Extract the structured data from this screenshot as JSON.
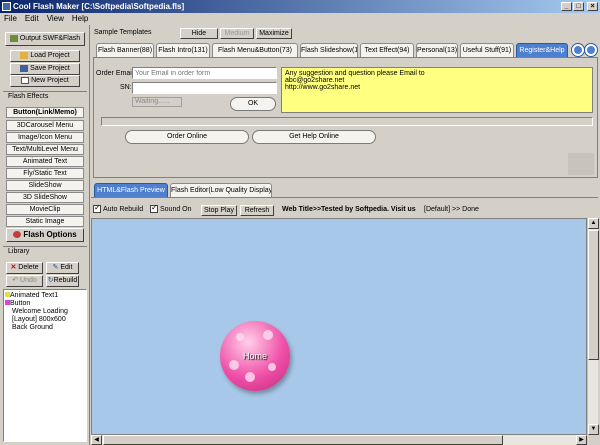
{
  "window": {
    "title": "Cool Flash Maker [C:\\Softpedia\\Softpedia.fls]",
    "min": "_",
    "max": "□",
    "close": "×"
  },
  "menu": [
    "File",
    "Edit",
    "View",
    "Help"
  ],
  "left": {
    "output": "Output SWF&Flash",
    "load": "Load Project",
    "save": "Save Project",
    "new": "New Project",
    "effects_title": "Flash Effects",
    "effects": [
      "Button(Link/Memo)",
      "3DCarousel Menu",
      "Image/Icon Menu",
      "Text/MultiLevel Menu",
      "Animated Text",
      "Fly/Static Text",
      "SlideShow",
      "3D SlideShow",
      "MovieClip",
      "Static Image"
    ],
    "options": "Flash Options",
    "library_title": "Library",
    "lib_delete": "Delete",
    "lib_edit": "Edit",
    "lib_undo": "Undo",
    "lib_rebuild": "Rebuild",
    "tree": [
      "Animated Text1",
      "Button",
      "Welcome Loading",
      "[Layout] 800x600",
      "Back Ground"
    ]
  },
  "templates": {
    "label": "Sample Templates",
    "hide": "Hide",
    "medium": "Medium",
    "maximize": "Maximize"
  },
  "tabs": [
    "Flash Banner(88)",
    "Flash Intro(131)",
    "Flash Menu&Button(73)",
    "Flash Slideshow(19)",
    "Text Effect(94)",
    "Personal(13)",
    "Useful Stuff(91)",
    "Register&Help"
  ],
  "register": {
    "email_label": "Order Email:",
    "email_placeholder": "Your Email in order form",
    "sn_label": "SN:",
    "sn_value": "",
    "status": "Waiting......",
    "ok": "OK",
    "info": [
      "Any suggestion and question please Email to",
      "abc@go2share.net",
      "http://www.go2share.net"
    ],
    "order": "Order Online",
    "help": "Get Help Online"
  },
  "preview_tabs": [
    "HTML&Flash Preview",
    "Flash Editor(Low Quality Display)"
  ],
  "toolbar": {
    "auto": "Auto Rebuild",
    "sound": "Sound On",
    "stop": "Stop Play",
    "refresh": "Refresh",
    "webtitle": "Web Title>>Tested by Softpedia. Visit us",
    "status": "[Default] >> Done"
  },
  "canvas": {
    "button_label": "Home"
  },
  "colors": {
    "canvas": "#a8c8ea",
    "active_tab": "#4f7fcf",
    "info_bg": "#ffff80"
  }
}
